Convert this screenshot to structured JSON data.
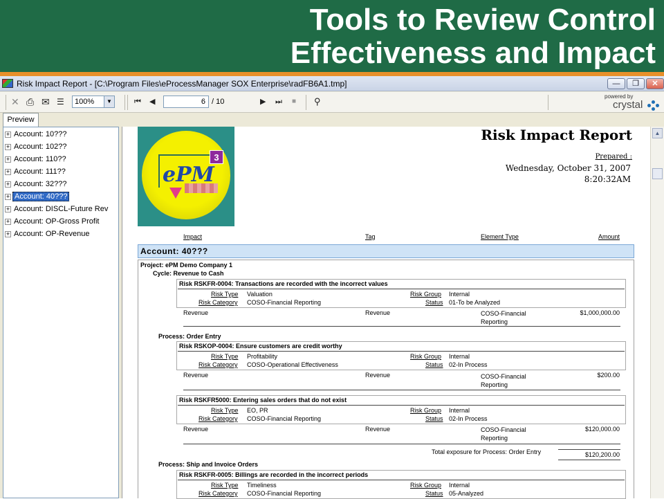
{
  "slide": {
    "title_line1": "Tools to Review Control",
    "title_line2": "Effectiveness and Impact"
  },
  "window": {
    "title": "Risk Impact Report - [C:\\Program Files\\eProcessManager SOX Enterprise\\radFB6A1.tmp]",
    "minimize": "—",
    "restore": "❐",
    "close": "✕"
  },
  "toolbar": {
    "zoom": "100%",
    "page_current": "6",
    "page_total": "/ 10",
    "powered_by": "powered by",
    "brand": "crystal"
  },
  "tabs": {
    "preview": "Preview"
  },
  "tree": {
    "plus": "+",
    "items": [
      "Account: 10???",
      "Account: 102??",
      "Account: 110??",
      "Account: 111??",
      "Account: 32???",
      "Account: 40???",
      "Account: DISCL-Future Rev",
      "Account: OP-Gross Profit",
      "Account: OP-Revenue"
    ]
  },
  "report": {
    "logo_text": "ePM",
    "logo_badge": "3",
    "title": "Risk Impact Report",
    "prepared_label": "Prepared :",
    "date": "Wednesday, October 31, 2007",
    "time": "8:20:32AM",
    "columns": {
      "impact": "Impact",
      "tag": "Tag",
      "element_type": "Element Type",
      "amount": "Amount"
    },
    "account": "Account: 40???",
    "project": "Project: ePM Demo Company 1",
    "cycle": "Cycle: Revenue to Cash",
    "labels": {
      "risk_type": "Risk Type",
      "risk_category": "Risk Category",
      "risk_group": "Risk Group",
      "status": "Status"
    },
    "risks": [
      {
        "title": "Risk RSKFR-0004: Transactions are recorded with the incorrect values",
        "risk_type": "Valuation",
        "risk_category": "COSO-Financial Reporting",
        "risk_group": "Internal",
        "status": "01-To be Analyzed",
        "impact": "Revenue",
        "tag": "Revenue",
        "element_type_1": "COSO-Financial",
        "element_type_2": "Reporting",
        "amount": "$1,000,000.00"
      },
      {
        "title": "Risk RSKOP-0004: Ensure customers are credit worthy",
        "risk_type": "Profitability",
        "risk_category": "COSO-Operational Effectiveness",
        "risk_group": "Internal",
        "status": "02-In Process",
        "impact": "Revenue",
        "tag": "Revenue",
        "element_type_1": "COSO-Financial",
        "element_type_2": "Reporting",
        "amount": "$200.00"
      },
      {
        "title": "Risk RSKFR5000: Entering sales orders that do not exist",
        "risk_type": "EO, PR",
        "risk_category": "COSO-Financial Reporting",
        "risk_group": "Internal",
        "status": "02-In Process",
        "impact": "Revenue",
        "tag": "Revenue",
        "element_type_1": "COSO-Financial",
        "element_type_2": "Reporting",
        "amount": "$120,000.00"
      },
      {
        "title": "Risk RSKFR-0005: Billings are recorded in the incorrect periods",
        "risk_type": "Timeliness",
        "risk_category": "COSO-Financial Reporting",
        "risk_group": "Internal",
        "status": "05-Analyzed"
      }
    ],
    "process_order_entry": "Process: Order Entry",
    "total_label": "Total exposure for Process: Order Entry",
    "total_amount": "$120,200.00",
    "process_ship": "Process: Ship and Invoice Orders"
  }
}
